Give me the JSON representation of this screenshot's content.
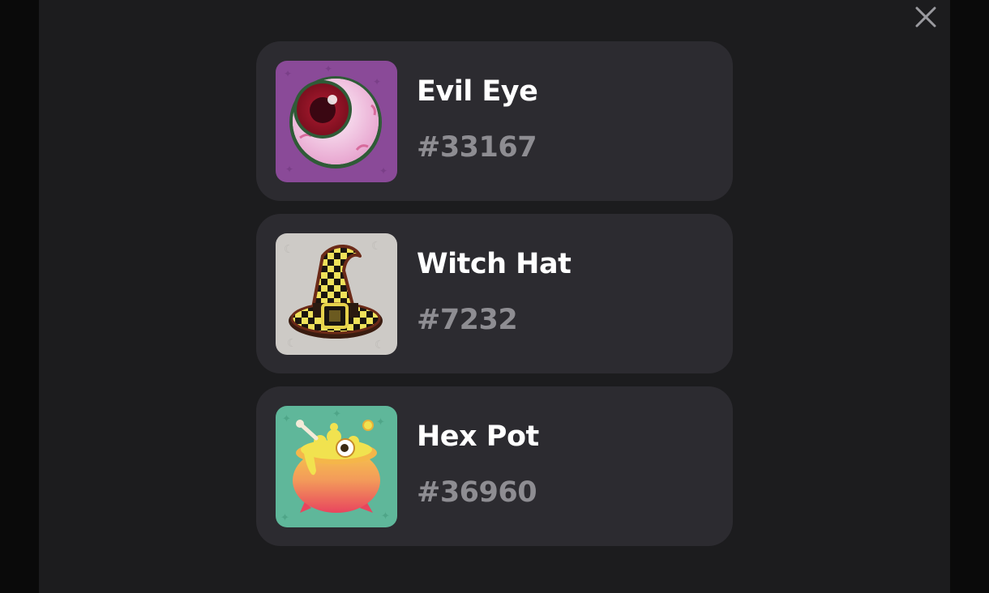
{
  "modal": {
    "close_icon": "close-icon",
    "items": [
      {
        "name": "Evil Eye",
        "number": "#33167",
        "icon": "evil-eye-icon",
        "bg": "#8a4a98"
      },
      {
        "name": "Witch Hat",
        "number": "#7232",
        "icon": "witch-hat-icon",
        "bg": "#cdcac6"
      },
      {
        "name": "Hex Pot",
        "number": "#36960",
        "icon": "cauldron-icon",
        "bg": "#5fb79a"
      }
    ]
  },
  "colors": {
    "background": "#1c1c1e",
    "card": "#2c2b30",
    "title": "#ffffff",
    "number": "#8e8d92"
  }
}
